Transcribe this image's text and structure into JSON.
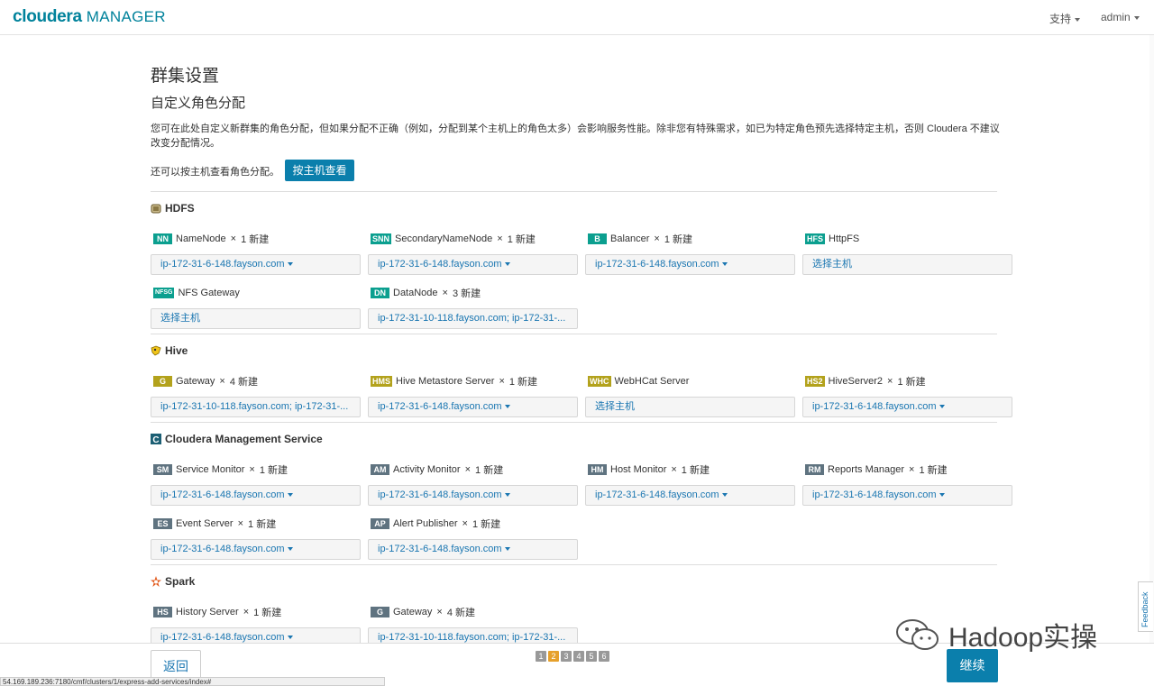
{
  "topbar": {
    "logo_main": "cloudera",
    "logo_sub": "MANAGER",
    "support_label": "支持",
    "user_label": "admin"
  },
  "page": {
    "title": "群集设置",
    "subtitle": "自定义角色分配",
    "description": "您可在此处自定义新群集的角色分配，但如果分配不正确（例如，分配到某个主机上的角色太多）会影响服务性能。除非您有特殊需求，如已为特定角色预先选择特定主机，否则 Cloudera 不建议改变分配情况。",
    "host_view_prompt": "还可以按主机查看角色分配。",
    "host_view_button": "按主机查看"
  },
  "services": [
    {
      "name": "HDFS",
      "icon": "hdfs-icon",
      "roles": [
        {
          "badge": "NN",
          "badge_color": "#0b9f8f",
          "name": "NameNode",
          "times": "×",
          "count": "1 新建",
          "value": "ip-172-31-6-148.fayson.com",
          "dropdown": true
        },
        {
          "badge": "SNN",
          "badge_color": "#0b9f8f",
          "name": "SecondaryNameNode",
          "times": "×",
          "count": "1 新建",
          "value": "ip-172-31-6-148.fayson.com",
          "dropdown": true
        },
        {
          "badge": "B",
          "badge_color": "#0b9f8f",
          "name": "Balancer",
          "times": "×",
          "count": "1 新建",
          "value": "ip-172-31-6-148.fayson.com",
          "dropdown": true
        },
        {
          "badge": "HFS",
          "badge_color": "#0b9f8f",
          "name": "HttpFS",
          "times": "",
          "count": "",
          "value": "选择主机",
          "dropdown": false
        },
        {
          "badge": "NFSG",
          "badge_color": "#0b9f8f",
          "name": "NFS Gateway",
          "times": "",
          "count": "",
          "value": "选择主机",
          "dropdown": false
        },
        {
          "badge": "DN",
          "badge_color": "#0b9f8f",
          "name": "DataNode",
          "times": "×",
          "count": "3 新建",
          "value": "ip-172-31-10-118.fayson.com; ip-172-31-...",
          "dropdown": false
        }
      ]
    },
    {
      "name": "Hive",
      "icon": "hive-icon",
      "roles": [
        {
          "badge": "G",
          "badge_color": "#b3a21c",
          "name": "Gateway",
          "times": "×",
          "count": "4 新建",
          "value": "ip-172-31-10-118.fayson.com; ip-172-31-...",
          "dropdown": false
        },
        {
          "badge": "HMS",
          "badge_color": "#b3a21c",
          "name": "Hive Metastore Server",
          "times": "×",
          "count": "1 新建",
          "value": "ip-172-31-6-148.fayson.com",
          "dropdown": true
        },
        {
          "badge": "WHC",
          "badge_color": "#b3a21c",
          "name": "WebHCat Server",
          "times": "",
          "count": "",
          "value": "选择主机",
          "dropdown": false
        },
        {
          "badge": "HS2",
          "badge_color": "#b3a21c",
          "name": "HiveServer2",
          "times": "×",
          "count": "1 新建",
          "value": "ip-172-31-6-148.fayson.com",
          "dropdown": true
        }
      ]
    },
    {
      "name": "Cloudera Management Service",
      "icon": "cloudera-management-icon",
      "roles": [
        {
          "badge": "SM",
          "badge_color": "#5f7380",
          "name": "Service Monitor",
          "times": "×",
          "count": "1 新建",
          "value": "ip-172-31-6-148.fayson.com",
          "dropdown": true
        },
        {
          "badge": "AM",
          "badge_color": "#5f7380",
          "name": "Activity Monitor",
          "times": "×",
          "count": "1 新建",
          "value": "ip-172-31-6-148.fayson.com",
          "dropdown": true
        },
        {
          "badge": "HM",
          "badge_color": "#5f7380",
          "name": "Host Monitor",
          "times": "×",
          "count": "1 新建",
          "value": "ip-172-31-6-148.fayson.com",
          "dropdown": true
        },
        {
          "badge": "RM",
          "badge_color": "#5f7380",
          "name": "Reports Manager",
          "times": "×",
          "count": "1 新建",
          "value": "ip-172-31-6-148.fayson.com",
          "dropdown": true
        },
        {
          "badge": "ES",
          "badge_color": "#5f7380",
          "name": "Event Server",
          "times": "×",
          "count": "1 新建",
          "value": "ip-172-31-6-148.fayson.com",
          "dropdown": true
        },
        {
          "badge": "AP",
          "badge_color": "#5f7380",
          "name": "Alert Publisher",
          "times": "×",
          "count": "1 新建",
          "value": "ip-172-31-6-148.fayson.com",
          "dropdown": true
        }
      ]
    },
    {
      "name": "Spark",
      "icon": "spark-icon",
      "roles": [
        {
          "badge": "HS",
          "badge_color": "#5f7380",
          "name": "History Server",
          "times": "×",
          "count": "1 新建",
          "value": "ip-172-31-6-148.fayson.com",
          "dropdown": true
        },
        {
          "badge": "G",
          "badge_color": "#5f7380",
          "name": "Gateway",
          "times": "×",
          "count": "4 新建",
          "value": "ip-172-31-10-118.fayson.com; ip-172-31-...",
          "dropdown": false
        }
      ]
    }
  ],
  "footer": {
    "back_label": "返回",
    "continue_label": "继续",
    "pages": [
      "1",
      "2",
      "3",
      "4",
      "5",
      "6"
    ],
    "active_page": "2"
  },
  "statusbar": "54.169.189.236:7180/cmf/clusters/1/express-add-services/index#",
  "watermark": "Hadoop实操",
  "feedback": "Feedback",
  "colors": {
    "brand": "#00829b",
    "primary_button": "#0b7fac",
    "link": "#1a76b1",
    "hdfs_badge": "#0b9f8f",
    "hive_badge": "#b3a21c",
    "mgmt_badge": "#5f7380",
    "active_page": "#e6a02b"
  }
}
